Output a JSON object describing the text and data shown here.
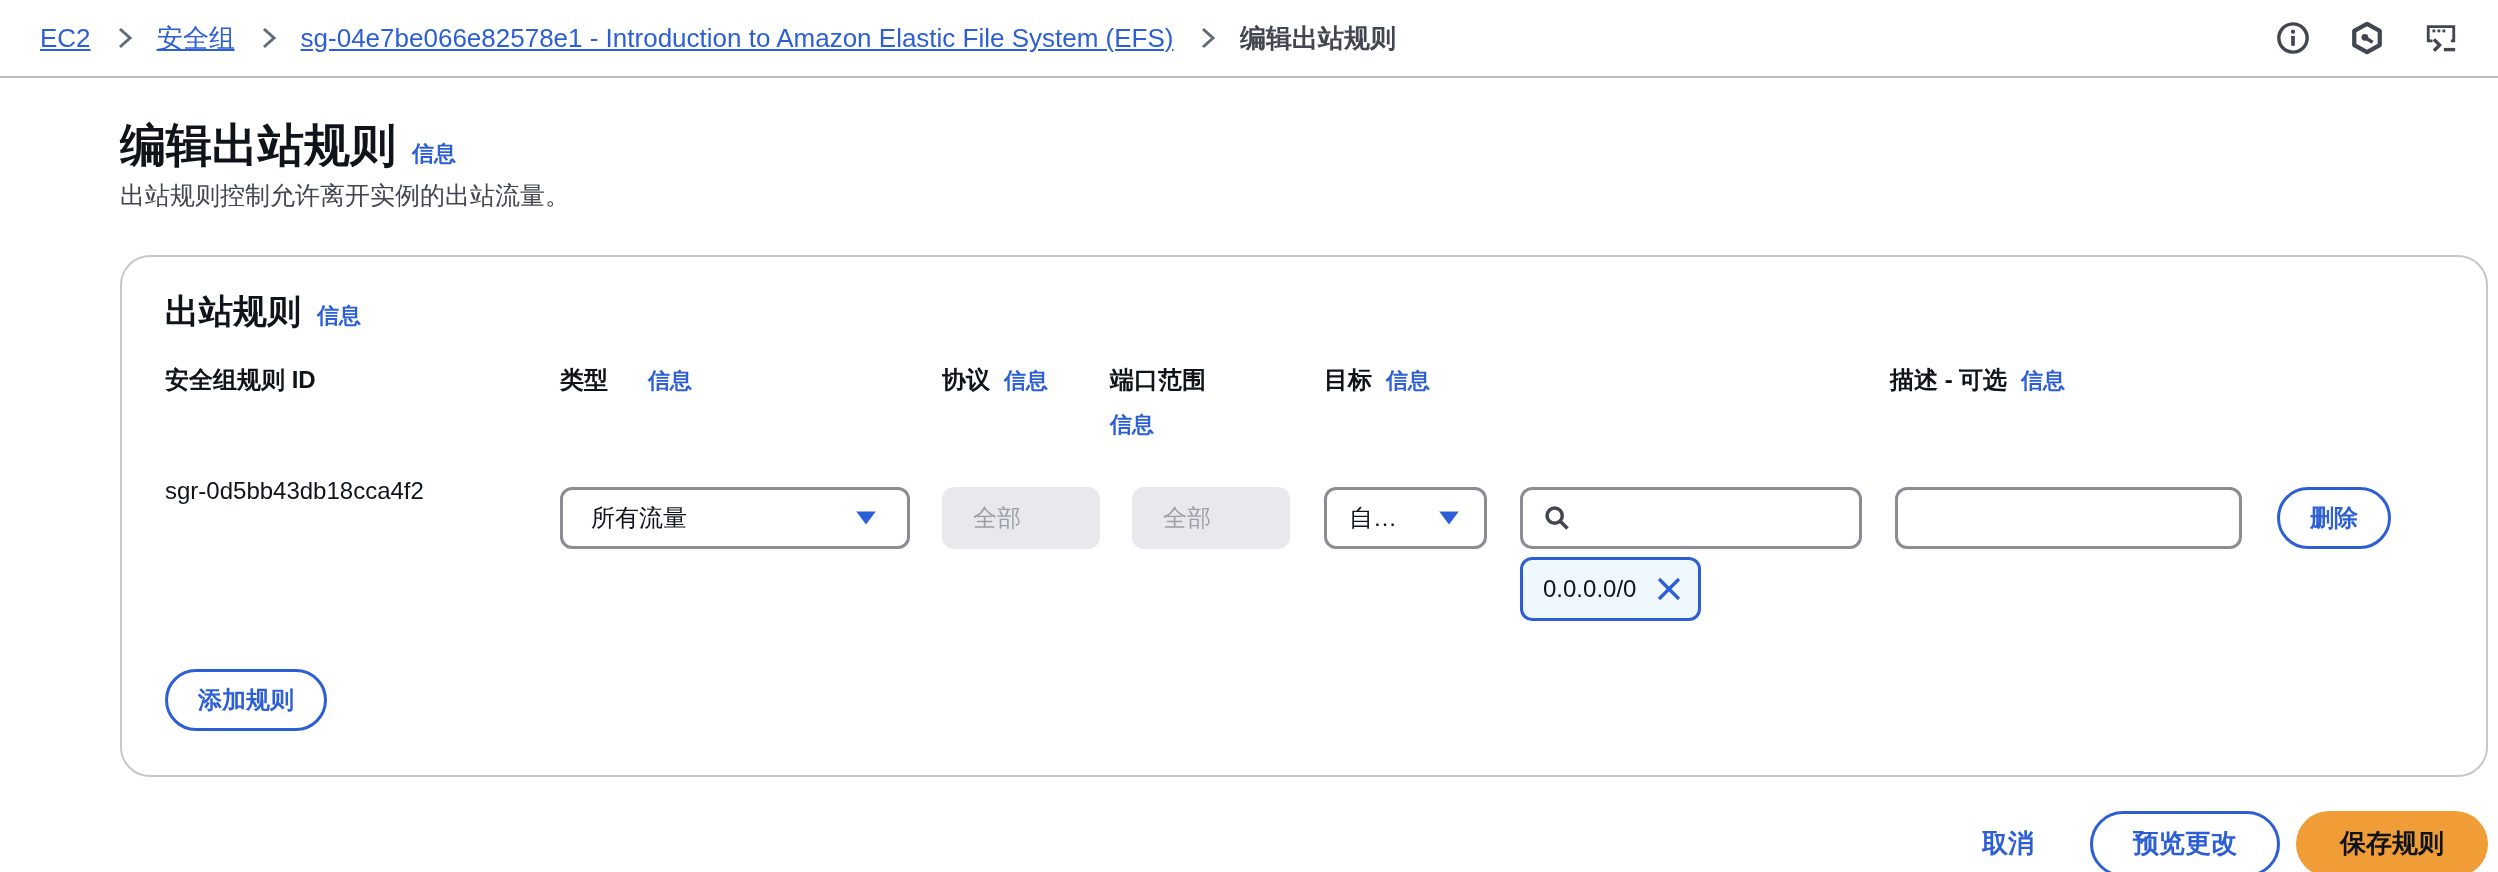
{
  "breadcrumb": [
    {
      "label": "EC2",
      "kind": "link"
    },
    {
      "label": "安全组",
      "kind": "link"
    },
    {
      "label": "sg-04e7be066e82578e1 - Introduction to Amazon Elastic File System (EFS)",
      "kind": "link"
    },
    {
      "label": "编辑出站规则",
      "kind": "current"
    }
  ],
  "page": {
    "title": "编辑出站规则",
    "info_link": "信息",
    "description": "出站规则控制允许离开实例的出站流量。"
  },
  "rules_panel": {
    "title": "出站规则",
    "info_link": "信息",
    "columns": [
      {
        "label": "安全组规则 ID"
      },
      {
        "label": "类型",
        "info": "信息"
      },
      {
        "label": "协议",
        "info": "信息"
      },
      {
        "label": "端口范围",
        "info": "信息"
      },
      {
        "label": "目标",
        "info": "信息"
      },
      {
        "label": "描述 - 可选",
        "info": "信息"
      }
    ],
    "rows": [
      {
        "rule_id": "sgr-0d5bb43db18cca4f2",
        "type": "所有流量",
        "protocol": {
          "value": "全部",
          "disabled": true
        },
        "port_range": {
          "value": "全部",
          "disabled": true
        },
        "destination": "自…",
        "destination_tokens": [
          "0.0.0.0/0"
        ],
        "delete_button": "删除"
      }
    ],
    "add_button": "添加规则"
  },
  "footer_buttons": [
    {
      "label": "取消",
      "kind": "link"
    },
    {
      "label": "预览更改",
      "kind": "secondary"
    },
    {
      "label": "保存规则",
      "kind": "primary"
    }
  ]
}
